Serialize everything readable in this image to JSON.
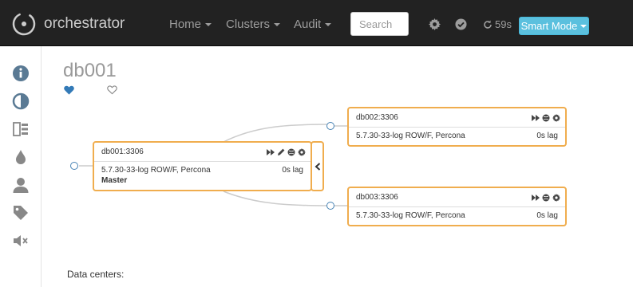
{
  "navbar": {
    "brand": "orchestrator",
    "menus": [
      {
        "label": "Home",
        "icon": "chevron-down-icon"
      },
      {
        "label": "Clusters",
        "icon": "chevron-down-icon"
      },
      {
        "label": "Audit",
        "icon": "chevron-down-icon"
      }
    ],
    "search_placeholder": "Search",
    "refresh_countdown": "59s",
    "mode_button": "Smart Mode"
  },
  "sidebar": {
    "icons": [
      "info-icon",
      "contrast-icon",
      "cluster-list-icon",
      "drop-icon",
      "user-icon",
      "tag-icon",
      "mute-icon"
    ]
  },
  "main": {
    "title": "db001",
    "data_centers_label": "Data centers:"
  },
  "topology": {
    "master": {
      "title": "db001:3306",
      "version": "5.7.30-33-log ROW/F, Percona",
      "lag": "0s lag",
      "role": "Master"
    },
    "replicas": [
      {
        "title": "db002:3306",
        "version": "5.7.30-33-log ROW/F, Percona",
        "lag": "0s lag"
      },
      {
        "title": "db003:3306",
        "version": "5.7.30-33-log ROW/F, Percona",
        "lag": "0s lag"
      }
    ]
  },
  "colors": {
    "navbar_bg": "#222222",
    "node_border": "#f0ad4e",
    "accent": "#5bc0de",
    "sidebar_icon": "#5a7a94",
    "link_dot": "#4682b4"
  }
}
